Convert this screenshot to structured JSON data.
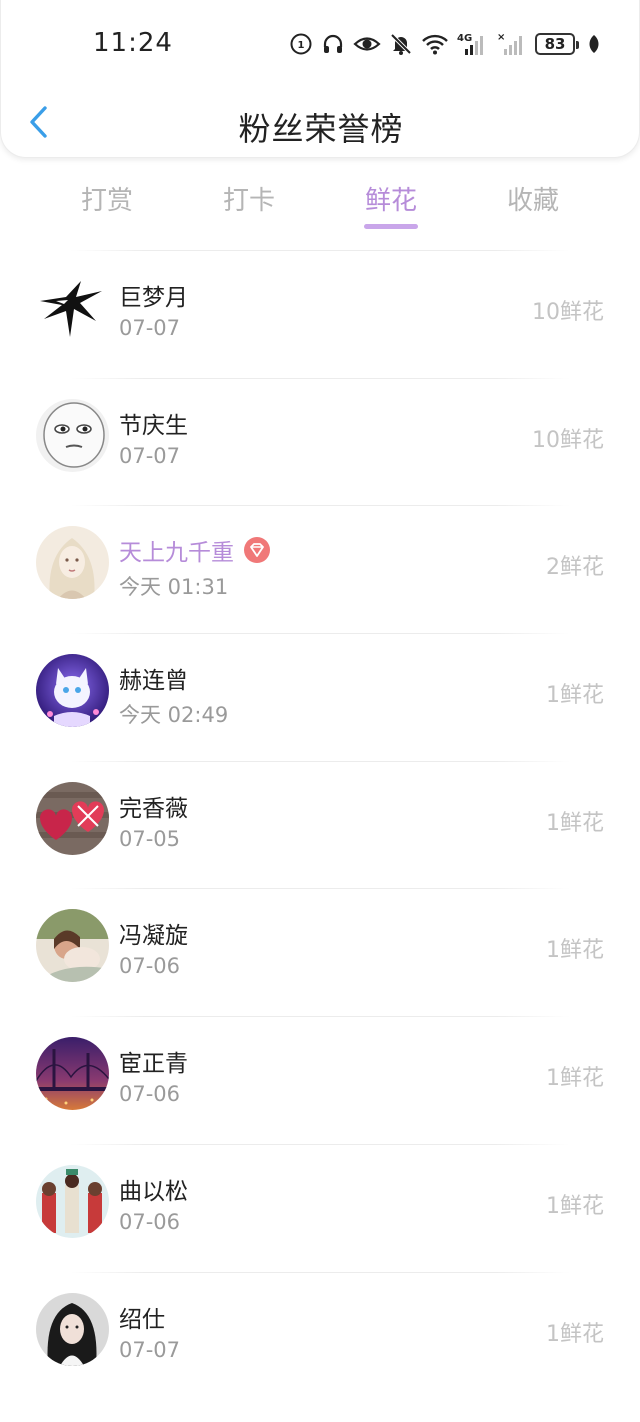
{
  "status_bar": {
    "time": "11:24",
    "battery": "83",
    "icons": [
      "hd-call-icon",
      "headphones-icon",
      "eye-icon",
      "mute-bell-icon",
      "wifi-icon",
      "signal-4g-icon",
      "signal-no-sim-icon",
      "battery-icon",
      "leaf-icon"
    ],
    "network_label": "4G"
  },
  "nav": {
    "title": "粉丝荣誉榜",
    "back_icon": "chevron-left-icon",
    "accent": "#3a9ee8"
  },
  "tabs": [
    {
      "label": "打赏",
      "active": false
    },
    {
      "label": "打卡",
      "active": false
    },
    {
      "label": "鲜花",
      "active": true
    },
    {
      "label": "收藏",
      "active": false
    }
  ],
  "colors": {
    "active_tab": "#b68cd9",
    "inactive_tab": "#b5b5b5",
    "vip_name": "#b68cd9",
    "vip_badge": "#f07878"
  },
  "fans": [
    {
      "name": "巨梦月",
      "date": "07-07",
      "count": "10鲜花",
      "vip": false,
      "avatar": "swallow-tattoo"
    },
    {
      "name": "节庆生",
      "date": "07-07",
      "count": "10鲜花",
      "vip": false,
      "avatar": "cartoon-face"
    },
    {
      "name": "天上九千重",
      "date": "今天 01:31",
      "count": "2鲜花",
      "vip": true,
      "avatar": "anime-girl"
    },
    {
      "name": "赫连曾",
      "date": "今天 02:49",
      "count": "1鲜花",
      "vip": false,
      "avatar": "white-cat"
    },
    {
      "name": "完香薇",
      "date": "07-05",
      "count": "1鲜花",
      "vip": false,
      "avatar": "fabric-hearts"
    },
    {
      "name": "冯凝旋",
      "date": "07-06",
      "count": "1鲜花",
      "vip": false,
      "avatar": "people-photo"
    },
    {
      "name": "宦正青",
      "date": "07-06",
      "count": "1鲜花",
      "vip": false,
      "avatar": "bridge-night"
    },
    {
      "name": "曲以松",
      "date": "07-06",
      "count": "1鲜花",
      "vip": false,
      "avatar": "cartoon-group"
    },
    {
      "name": "绍仕",
      "date": "07-07",
      "count": "1鲜花",
      "vip": false,
      "avatar": "girl-photo"
    }
  ]
}
